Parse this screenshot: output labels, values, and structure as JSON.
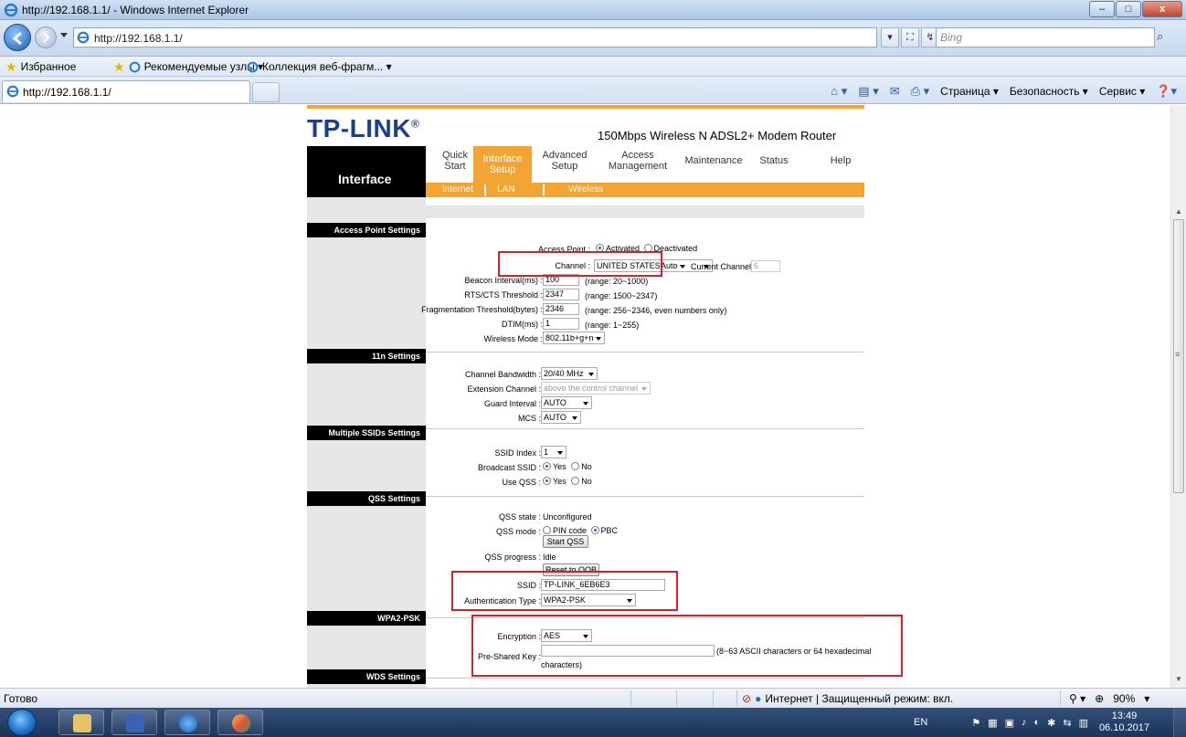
{
  "window": {
    "title": "http://192.168.1.1/ - Windows Internet Explorer",
    "min": "–",
    "max": "□",
    "close": "x"
  },
  "nav": {
    "url": "http://192.168.1.1/",
    "search_placeholder": "Bing",
    "tools": [
      "▾",
      "⛶",
      "↯",
      "✕"
    ]
  },
  "favorites": {
    "label": "Избранное",
    "items": [
      "Рекомендуемые узлы ▾",
      "Коллекция веб-фрагм... ▾"
    ]
  },
  "tab": {
    "label": "http://192.168.1.1/"
  },
  "commands": [
    "Страница ▾",
    "Безопасность ▾",
    "Сервис ▾"
  ],
  "router": {
    "logo": "TP-LINK",
    "model": "150Mbps Wireless N ADSL2+ Modem Router",
    "section_title": "Interface",
    "menu": [
      {
        "l1": "Quick",
        "l2": "Start"
      },
      {
        "l1": "Interface",
        "l2": "Setup"
      },
      {
        "l1": "Advanced",
        "l2": "Setup"
      },
      {
        "l1": "Access",
        "l2": "Management"
      },
      {
        "l1": "Maintenance",
        "l2": ""
      },
      {
        "l1": "Status",
        "l2": ""
      },
      {
        "l1": "Help",
        "l2": ""
      }
    ],
    "submenu": [
      "Internet",
      "LAN",
      "Wireless"
    ],
    "sections": {
      "ap": "Access Point Settings",
      "n11": "11n Settings",
      "mssid": "Multiple SSIDs Settings",
      "qss": "QSS Settings",
      "wpa": "WPA2-PSK",
      "wds": "WDS Settings"
    },
    "ap": {
      "access_point_label": "Access Point :",
      "activated": "Activated",
      "deactivated": "Deactivated",
      "channel_label": "Channel :",
      "channel_country": "UNITED STATES",
      "channel_value": "Auto",
      "current_channel_label": "Current Channel:",
      "current_channel_value": "6",
      "beacon_label": "Beacon Interval(ms) :",
      "beacon_value": "100",
      "beacon_hint": "(range: 20~1000)",
      "rts_label": "RTS/CTS Threshold :",
      "rts_value": "2347",
      "rts_hint": "(range: 1500~2347)",
      "frag_label": "Fragmentation Threshold(bytes) :",
      "frag_value": "2346",
      "frag_hint": "(range: 256~2346, even numbers only)",
      "dtim_label": "DTIM(ms) :",
      "dtim_value": "1",
      "dtim_hint": "(range: 1~255)",
      "mode_label": "Wireless Mode :",
      "mode_value": "802.11b+g+n"
    },
    "n11": {
      "bw_label": "Channel Bandwidth :",
      "bw_value": "20/40 MHz",
      "ext_label": "Extension Channel :",
      "ext_value": "above the control channel",
      "guard_label": "Guard Interval :",
      "guard_value": "AUTO",
      "mcs_label": "MCS :",
      "mcs_value": "AUTO"
    },
    "mssid": {
      "index_label": "SSID Index :",
      "index_value": "1",
      "broadcast_label": "Broadcast SSID :",
      "use_qss_label": "Use QSS :",
      "yes": "Yes",
      "no": "No"
    },
    "qss": {
      "state_label": "QSS state :",
      "state_value": "Unconfigured",
      "mode_label": "QSS mode :",
      "pin": "PIN code",
      "pbc": "PBC",
      "start_btn": "Start QSS",
      "progress_label": "QSS progress :",
      "progress_value": "Idle",
      "reset_btn": "Reset to OOB",
      "ssid_label": "SSID :",
      "ssid_value": "TP-LINK_6EB6E3",
      "auth_label": "Authentication Type :",
      "auth_value": "WPA2-PSK"
    },
    "wpa": {
      "enc_label": "Encryption :",
      "enc_value": "AES",
      "psk_label": "Pre-Shared Key :",
      "psk_value": "",
      "psk_hint": "(8~63 ASCII characters or 64 hexadecimal",
      "psk_hint2": "characters)"
    }
  },
  "status": {
    "ready": "Готово",
    "zone": "Интернет | Защищенный режим: вкл.",
    "zoom": "90%"
  },
  "taskbar": {
    "lang": "EN",
    "time": "13:49",
    "date": "06.10.2017"
  },
  "colors": {
    "accent": "#f3a533",
    "brand": "#1b3f8f",
    "highlight": "#d6202b"
  }
}
